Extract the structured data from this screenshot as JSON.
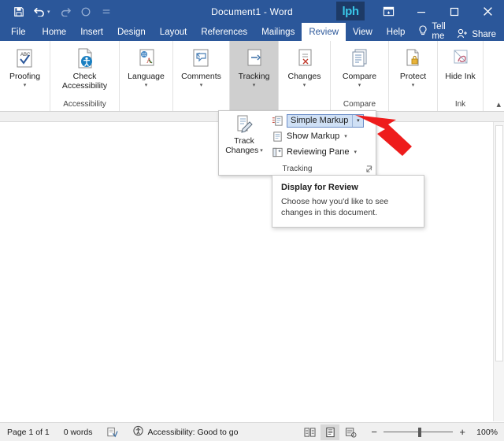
{
  "window": {
    "title": "Document1 - Word",
    "watermark": "lph",
    "quick_access": [
      {
        "name": "save-icon",
        "glyph": "὚B"
      },
      {
        "name": "undo-icon",
        "glyph": "↶"
      },
      {
        "name": "redo-icon",
        "glyph": "↷"
      },
      {
        "name": "repeat-icon",
        "glyph": "○"
      },
      {
        "name": "customize-quick-access-icon",
        "glyph": "≡"
      }
    ],
    "controls": {
      "ribbon_display_options": "⬚",
      "minimize": "–",
      "maximize": "☐",
      "close": "✕"
    }
  },
  "tabs": [
    {
      "label": "File",
      "active": false
    },
    {
      "label": "Home",
      "active": false
    },
    {
      "label": "Insert",
      "active": false
    },
    {
      "label": "Design",
      "active": false
    },
    {
      "label": "Layout",
      "active": false
    },
    {
      "label": "References",
      "active": false
    },
    {
      "label": "Mailings",
      "active": false
    },
    {
      "label": "Review",
      "active": true
    },
    {
      "label": "View",
      "active": false
    },
    {
      "label": "Help",
      "active": false
    }
  ],
  "tell_me": "Tell me",
  "share": "Share",
  "ribbon": {
    "groups": [
      {
        "name": "",
        "active": false,
        "buttons": [
          {
            "label": "Proofing",
            "icon": "spelling-grammar-icon",
            "caret": true,
            "two_line": false
          }
        ]
      },
      {
        "name": "Accessibility",
        "active": false,
        "buttons": [
          {
            "label": "Check Accessibility",
            "icon": "check-accessibility-icon",
            "caret": true,
            "two_line": true
          }
        ]
      },
      {
        "name": "",
        "active": false,
        "buttons": [
          {
            "label": "Language",
            "icon": "language-icon",
            "caret": true,
            "two_line": false
          }
        ]
      },
      {
        "name": "",
        "active": false,
        "buttons": [
          {
            "label": "Comments",
            "icon": "comments-icon",
            "caret": true,
            "two_line": false
          }
        ]
      },
      {
        "name": "",
        "active": true,
        "buttons": [
          {
            "label": "Tracking",
            "icon": "tracking-icon",
            "caret": true,
            "two_line": false
          }
        ]
      },
      {
        "name": "",
        "active": false,
        "buttons": [
          {
            "label": "Changes",
            "icon": "changes-icon",
            "caret": true,
            "two_line": false
          }
        ]
      },
      {
        "name": "Compare",
        "active": false,
        "buttons": [
          {
            "label": "Compare",
            "icon": "compare-icon",
            "caret": true,
            "two_line": false
          }
        ]
      },
      {
        "name": "",
        "active": false,
        "buttons": [
          {
            "label": "Protect",
            "icon": "protect-icon",
            "caret": true,
            "two_line": false
          }
        ]
      },
      {
        "name": "Ink",
        "active": false,
        "buttons": [
          {
            "label": "Hide Ink",
            "icon": "hide-ink-icon",
            "caret": true,
            "two_line": true
          }
        ]
      }
    ],
    "collapse_icon": "chevron-up-icon"
  },
  "tracking_panel": {
    "group_name": "Tracking",
    "track_changes": {
      "line1": "Track",
      "line2": "Changes",
      "icon": "track-changes-icon"
    },
    "items": [
      {
        "label": "Simple Markup",
        "icon": "display-for-review-icon",
        "selected": true,
        "split": true
      },
      {
        "label": "Show Markup",
        "icon": "show-markup-icon",
        "selected": false,
        "split": false
      },
      {
        "label": "Reviewing Pane",
        "icon": "reviewing-pane-icon",
        "selected": false,
        "split": false
      }
    ],
    "dialog_launcher": "tracking-dialog-launcher-icon"
  },
  "tooltip": {
    "title": "Display for Review",
    "body": "Choose how you'd like to see changes in this document."
  },
  "annotation": {
    "arrow_color": "#ee1c1c",
    "name": "red-pointer-arrow"
  },
  "status_bar": {
    "page": "Page 1 of 1",
    "words": "0 words",
    "proofing_icon": "proofing-status-icon",
    "accessibility": "Accessibility: Good to go",
    "accessibility_icon": "accessibility-status-icon",
    "views": [
      {
        "name": "read-mode-view-button",
        "active": false
      },
      {
        "name": "print-layout-view-button",
        "active": true
      },
      {
        "name": "web-layout-view-button",
        "active": false
      }
    ],
    "zoom_out": "−",
    "zoom_in": "+",
    "zoom_level": "100%"
  },
  "colors": {
    "word_blue": "#2b579a",
    "ribbon_active_group": "#cfcfcf",
    "selection_blue": "#cfe0f5",
    "arrow_red": "#ee1c1c"
  }
}
